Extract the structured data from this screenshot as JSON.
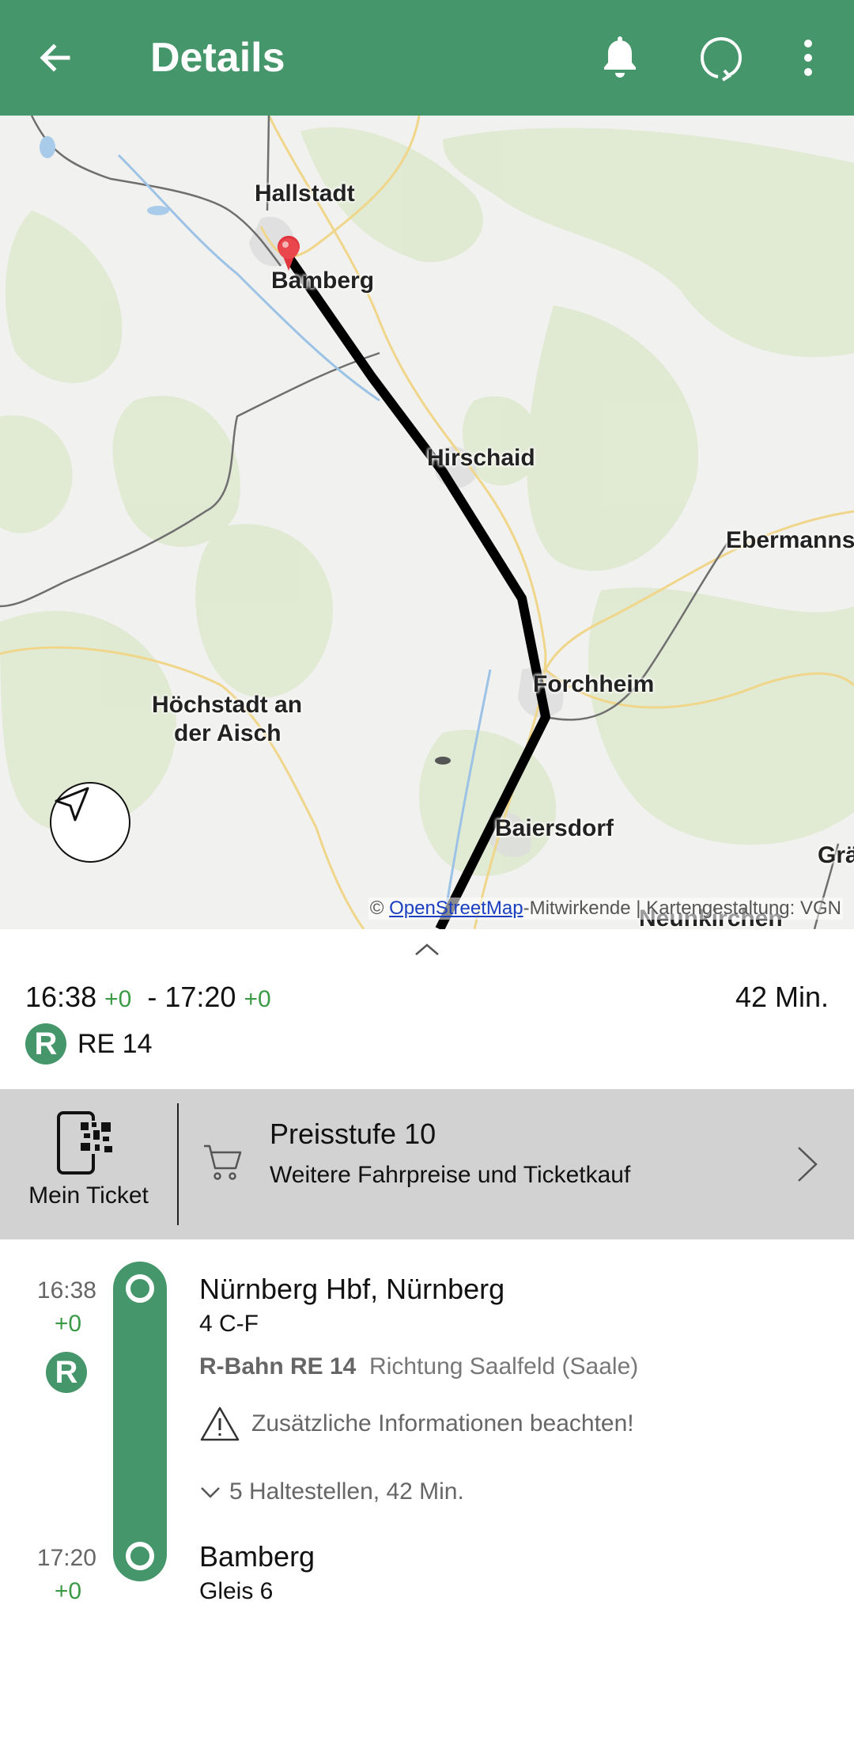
{
  "appbar": {
    "title": "Details",
    "color": "#45966a",
    "icons": [
      "back-arrow-icon",
      "bell-icon",
      "refresh-icon",
      "more-vert-icon"
    ]
  },
  "map": {
    "places": [
      "Hallstadt",
      "Bamberg",
      "Hirschaid",
      "Ebermanns",
      "Forchheim",
      "Höchstadt an",
      "der Aisch",
      "Baiersdorf",
      "Grä",
      "Neunkirchen"
    ],
    "attribution_prefix": "©",
    "attribution_link": "OpenStreetMap",
    "attribution_rest": "-Mitwirkende | Kartengestaltung: VGN"
  },
  "summary": {
    "dep_time": "16:38",
    "dep_delay": "+0",
    "separator": "-",
    "arr_time": "17:20",
    "arr_delay": "+0",
    "duration": "42 Min.",
    "line_badge": "R",
    "line": "RE 14"
  },
  "ticket": {
    "my_ticket_label": "Mein Ticket",
    "price_title": "Preisstufe 10",
    "price_subtitle": "Weitere Fahrpreise und Ticketkauf"
  },
  "route": {
    "start": {
      "time": "16:38",
      "delay": "+0",
      "name": "Nürnberg Hbf, Nürnberg",
      "platform": "4 C-F"
    },
    "badge": "R",
    "train_name": "R-Bahn RE 14",
    "direction": "Richtung Saalfeld (Saale)",
    "warning": "Zusätzliche Informationen beachten!",
    "stops_info": "5 Haltestellen, 42 Min.",
    "end": {
      "time": "17:20",
      "delay": "+0",
      "name": "Bamberg",
      "platform": "Gleis 6"
    }
  }
}
